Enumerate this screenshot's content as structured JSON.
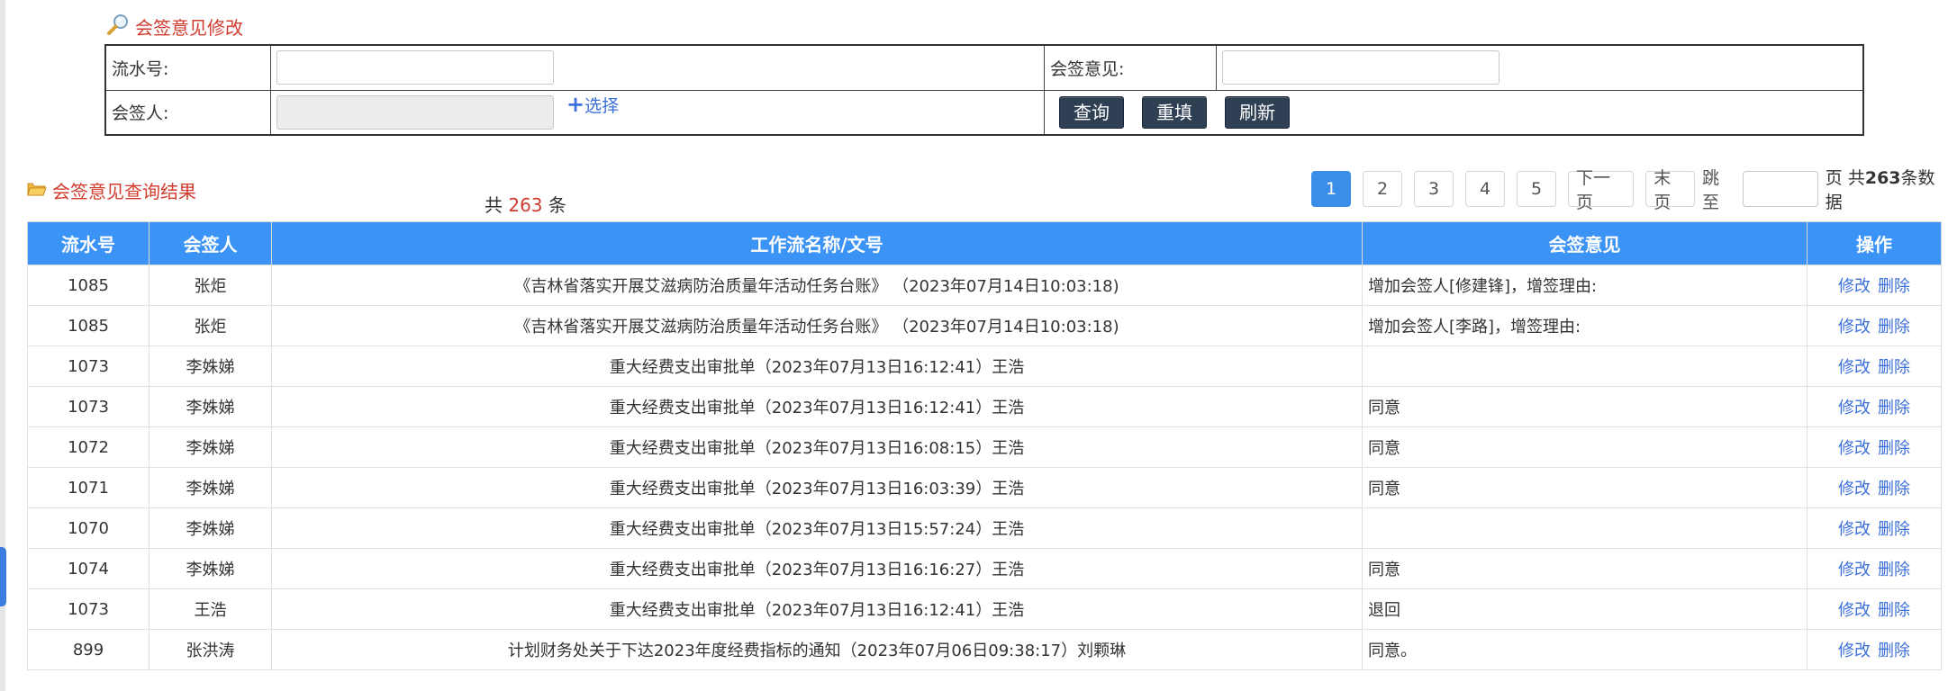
{
  "titles": {
    "edit": "会签意见修改",
    "result": "会签意见查询结果"
  },
  "search_form": {
    "serial_label": "流水号:",
    "serial_value": "",
    "opinion_label": "会签意见:",
    "opinion_value": "",
    "signer_label": "会签人:",
    "signer_value": "",
    "choose_label": "选择",
    "query_btn": "查询",
    "reset_btn": "重填",
    "refresh_btn": "刷新"
  },
  "total": {
    "prefix": "共",
    "count": "263",
    "suffix": "条"
  },
  "pagination": {
    "pages": [
      "1",
      "2",
      "3",
      "4",
      "5"
    ],
    "current": "1",
    "next": "下一页",
    "last": "末页",
    "jump_label": "跳至",
    "jump_value": "",
    "page_unit": "页",
    "total_prefix": "共",
    "total_count": "263",
    "total_suffix": "条数据"
  },
  "table": {
    "headers": [
      "流水号",
      "会签人",
      "工作流名称/文号",
      "会签意见",
      "操作"
    ],
    "edit_label": "修改",
    "delete_label": "删除",
    "rows": [
      {
        "id": "1085",
        "signer": "张炬",
        "workflow": "《吉林省落实开展艾滋病防治质量年活动任务台账》 （2023年07月14日10:03:18)",
        "opinion": "增加会签人[修建锋]，增签理由:"
      },
      {
        "id": "1085",
        "signer": "张炬",
        "workflow": "《吉林省落实开展艾滋病防治质量年活动任务台账》 （2023年07月14日10:03:18)",
        "opinion": "增加会签人[李路]，增签理由:"
      },
      {
        "id": "1073",
        "signer": "李姝娣",
        "workflow": "重大经费支出审批单（2023年07月13日16:12:41）王浩",
        "opinion": ""
      },
      {
        "id": "1073",
        "signer": "李姝娣",
        "workflow": "重大经费支出审批单（2023年07月13日16:12:41）王浩",
        "opinion": "同意"
      },
      {
        "id": "1072",
        "signer": "李姝娣",
        "workflow": "重大经费支出审批单（2023年07月13日16:08:15）王浩",
        "opinion": "同意"
      },
      {
        "id": "1071",
        "signer": "李姝娣",
        "workflow": "重大经费支出审批单（2023年07月13日16:03:39）王浩",
        "opinion": "同意"
      },
      {
        "id": "1070",
        "signer": "李姝娣",
        "workflow": "重大经费支出审批单（2023年07月13日15:57:24）王浩",
        "opinion": ""
      },
      {
        "id": "1074",
        "signer": "李姝娣",
        "workflow": "重大经费支出审批单（2023年07月13日16:16:27）王浩",
        "opinion": "同意"
      },
      {
        "id": "1073",
        "signer": "王浩",
        "workflow": "重大经费支出审批单（2023年07月13日16:12:41）王浩",
        "opinion": "退回"
      },
      {
        "id": "899",
        "signer": "张洪涛",
        "workflow": "计划财务处关于下达2023年度经费指标的通知（2023年07月06日09:38:17）刘颗琳",
        "opinion": "同意。"
      }
    ]
  },
  "icons": {
    "edit_title_icon": "magnifier-icon",
    "result_title_icon": "folder-icon",
    "choose_icon": "plus-icon"
  },
  "colors": {
    "title_red": "#d23c2f",
    "header_blue": "#3b93f5",
    "link_blue": "#3b6fd9",
    "button_dark": "#2f4054",
    "page_active": "#3b8ee8"
  }
}
